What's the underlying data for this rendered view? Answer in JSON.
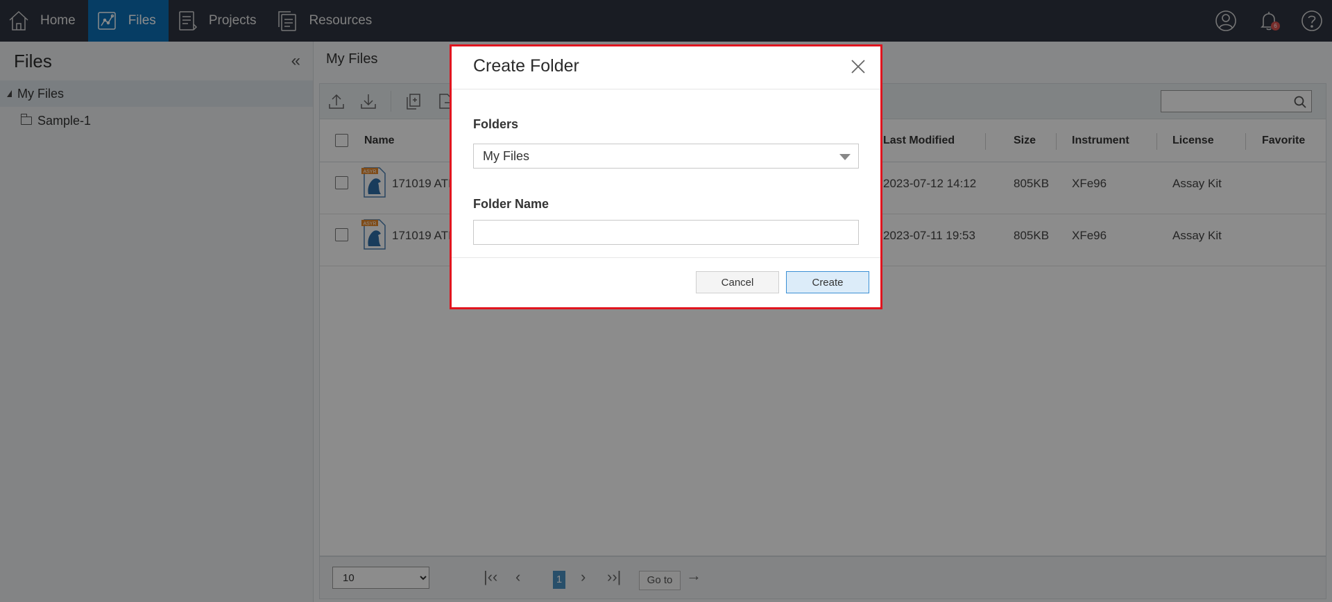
{
  "nav": {
    "items": [
      {
        "label": "Home",
        "icon": "home-icon"
      },
      {
        "label": "Files",
        "icon": "files-chart-icon",
        "active": true
      },
      {
        "label": "Projects",
        "icon": "projects-icon"
      },
      {
        "label": "Resources",
        "icon": "resources-icon"
      }
    ],
    "notifications_count": "6",
    "right_icons": [
      "user-icon",
      "bell-icon",
      "help-icon"
    ]
  },
  "sidebar": {
    "title": "Files",
    "tree": {
      "root": "My Files",
      "children": [
        "Sample-1"
      ]
    }
  },
  "main": {
    "breadcrumb": "My Files",
    "table": {
      "columns": {
        "name": "Name",
        "last_modified": "Last Modified",
        "size": "Size",
        "instrument": "Instrument",
        "license": "License",
        "favorite": "Favorite"
      },
      "rows": [
        {
          "name": "171019 ATI",
          "last_modified": "2023-07-12 14:12",
          "size": "805KB",
          "instrument": "XFe96",
          "license": "Assay Kit",
          "file_badge": "ASYR"
        },
        {
          "name": "171019 ATI",
          "last_modified": "2023-07-11 19:53",
          "size": "805KB",
          "instrument": "XFe96",
          "license": "Assay Kit",
          "file_badge": "ASYR"
        }
      ]
    },
    "pager": {
      "page_size": "10",
      "current_page": "1",
      "goto_label": "Go to"
    }
  },
  "modal": {
    "title": "Create Folder",
    "folders_label": "Folders",
    "folders_value": "My Files",
    "folder_name_label": "Folder Name",
    "folder_name_value": "",
    "cancel_label": "Cancel",
    "create_label": "Create",
    "highlight_color": "#e0141e"
  },
  "colors": {
    "nav_bg": "#2e3440",
    "nav_active": "#0b6fb6"
  }
}
